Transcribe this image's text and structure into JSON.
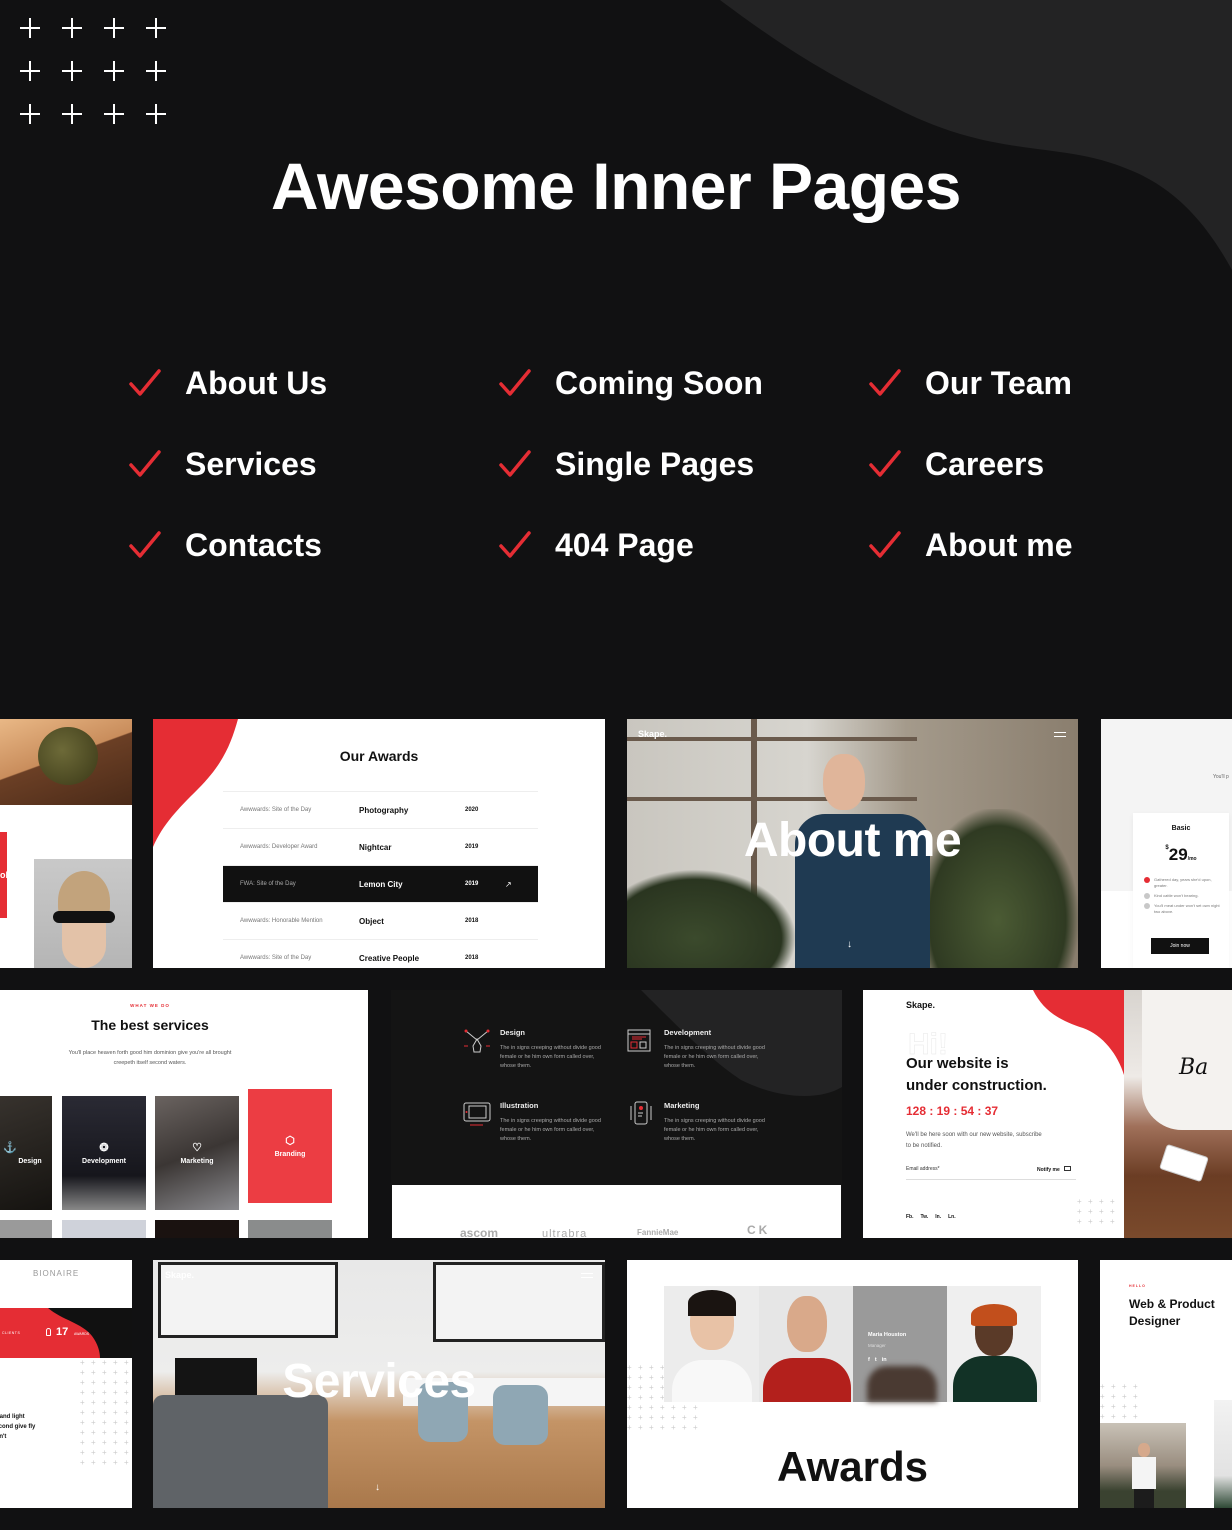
{
  "hero": {
    "title": "Awesome Inner Pages"
  },
  "colors": {
    "background": "#111112",
    "accent": "#e52d34",
    "curve": "#232324"
  },
  "features": [
    {
      "label": "About Us",
      "icon": "check-icon"
    },
    {
      "label": "Coming Soon",
      "icon": "check-icon"
    },
    {
      "label": "Our Team",
      "icon": "check-icon"
    },
    {
      "label": "Services",
      "icon": "check-icon"
    },
    {
      "label": "Single Pages",
      "icon": "check-icon"
    },
    {
      "label": "Careers",
      "icon": "check-icon"
    },
    {
      "label": "Contacts",
      "icon": "check-icon"
    },
    {
      "label": "404 Page",
      "icon": "check-icon"
    },
    {
      "label": "About me",
      "icon": "check-icon"
    }
  ],
  "previews": {
    "portfolio_partial": {
      "label_fragment": "ob"
    },
    "awards": {
      "title": "Our Awards",
      "rows": [
        {
          "award": "Awwwards: Site of the Day",
          "project": "Photography",
          "year": "2020",
          "active": false
        },
        {
          "award": "Awwwards: Developer Award",
          "project": "Nightcar",
          "year": "2019",
          "active": false
        },
        {
          "award": "FWA: Site of the Day",
          "project": "Lemon City",
          "year": "2019",
          "active": true
        },
        {
          "award": "Awwwards: Honorable Mention",
          "project": "Object",
          "year": "2018",
          "active": false
        },
        {
          "award": "Awwwards: Site of the Day",
          "project": "Creative People",
          "year": "2018",
          "active": false
        }
      ],
      "arrow": "↗"
    },
    "about_me": {
      "logo": "Skape.",
      "title": "About me",
      "scroll_icon": "↓"
    },
    "pricing": {
      "heading_fragment": "You'll p",
      "plan": "Basic",
      "currency": "$",
      "price": "29",
      "period": "/mo",
      "features": [
        {
          "text": "Gathered day, years she'd upon, greater.",
          "included": true
        },
        {
          "text": "Kind cattle won't bearing.",
          "included": false
        },
        {
          "text": "You'll meat under won't set own night two above.",
          "included": false
        }
      ],
      "cta": "Join now"
    },
    "services": {
      "eyebrow": "WHAT WE DO",
      "title": "The best services",
      "subtitle": "You'll place heaven forth good him dominion give you're all brought creepeth itself second waters.",
      "tiles": [
        {
          "label": "Design",
          "icon": "⚓"
        },
        {
          "label": "Development",
          "icon": "❂"
        },
        {
          "label": "Marketing",
          "icon": "♡"
        },
        {
          "label": "Branding",
          "icon": "⬡"
        }
      ]
    },
    "dark_services": {
      "items": [
        {
          "title": "Design",
          "desc": "The in signs creeping without divide good female or he him own form called over, whose them."
        },
        {
          "title": "Development",
          "desc": "The in signs creeping without divide good female or he him own form called over, whose them."
        },
        {
          "title": "Illustration",
          "desc": "The in signs creeping without divide good female or he him own form called over, whose them."
        },
        {
          "title": "Marketing",
          "desc": "The in signs creeping without divide good female or he him own form called over, whose them."
        }
      ],
      "clients": [
        "ascom",
        "ultrabra",
        "FannieMae",
        "CK"
      ]
    },
    "coming_soon": {
      "logo": "Skape.",
      "watermark": "Hi!",
      "title_line1": "Our website is",
      "title_line2": "under construction.",
      "countdown": "128 : 19 : 54 : 37",
      "text": "We'll be here soon with our new website, subscribe to be notified.",
      "email_placeholder": "Email address*",
      "notify_label": "Notify me",
      "socials": [
        "Fb.",
        "Tw.",
        "In.",
        "Ln."
      ]
    },
    "stats": {
      "brand": "BIONAIRE",
      "clients_label": "CLIENTS",
      "awards_count": "17",
      "awards_label": "AWARDS",
      "text": "or and light second give fly don't"
    },
    "services_hero": {
      "logo": "Skape.",
      "title": "Services",
      "scroll_icon": "↓"
    },
    "team": {
      "member_name": "Maria Houston",
      "member_role": "Manager",
      "socials": [
        "f",
        "t",
        "in"
      ],
      "title": "Awards"
    },
    "designer": {
      "eyebrow": "HELLO",
      "title_line1": "Web & Product",
      "title_line2": "Designer"
    }
  }
}
